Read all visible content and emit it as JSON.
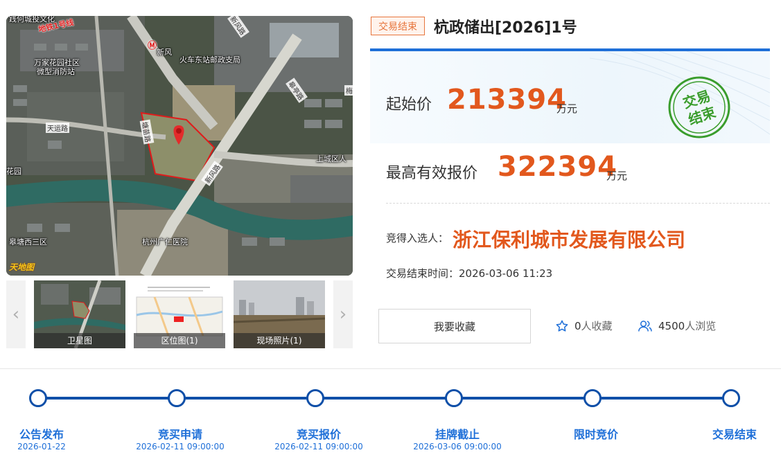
{
  "map": {
    "labels": {
      "metro_line": "地铁1号线",
      "metro_station": "新风",
      "post_office": "火车东站邮政支局",
      "community": "万家花园社区",
      "fire_station": "微型消防站",
      "road_tianyun": "天运路",
      "road_tangmiao": "塘苗路",
      "road_xinfeng": "新风路",
      "road_gaogong": "皋亭路",
      "road_mei": "梅",
      "road_xinfeng2": "新风路",
      "district": "上城区人",
      "garden": "花园",
      "gaotang": "皋塘西三区",
      "hospital": "杭州广仁医院",
      "topleft": "践何城投文化"
    },
    "logo": "天地图"
  },
  "thumbnails": [
    {
      "caption": "卫星图"
    },
    {
      "caption": "区位图(1)"
    },
    {
      "caption": "现场照片(1)"
    }
  ],
  "nav": {
    "prev": "‹",
    "next": "›"
  },
  "status_badge": "交易结束",
  "title": "杭政储出[2026]1号",
  "start_price": {
    "label": "起始价",
    "value": "213394",
    "unit": "万元"
  },
  "max_price": {
    "label": "最高有效报价",
    "value": "322394",
    "unit": "万元"
  },
  "stamp": {
    "line1": "交易",
    "line2": "结束"
  },
  "winner": {
    "label": "竞得入选人：",
    "name": "浙江保利城市发展有限公司"
  },
  "end_time": "交易结束时间：2026-03-06 11:23",
  "favorite_button": "我要收藏",
  "favorites": {
    "count": "0",
    "suffix": "人收藏"
  },
  "views": {
    "count": "4500",
    "suffix": "人浏览"
  },
  "colors": {
    "accent": "#1e6fd8",
    "price": "#e2581d",
    "stamp": "#3a9d2c",
    "timeline": "#0e4fa8"
  },
  "timeline": [
    {
      "label": "公告发布",
      "date": "2026-01-22"
    },
    {
      "label": "竞买申请",
      "date": "2026-02-11 09:00:00"
    },
    {
      "label": "竞买报价",
      "date": "2026-02-11 09:00:00"
    },
    {
      "label": "挂牌截止",
      "date": "2026-03-06 09:00:00"
    },
    {
      "label": "限时竞价",
      "date": ""
    },
    {
      "label": "交易结束",
      "date": ""
    }
  ]
}
